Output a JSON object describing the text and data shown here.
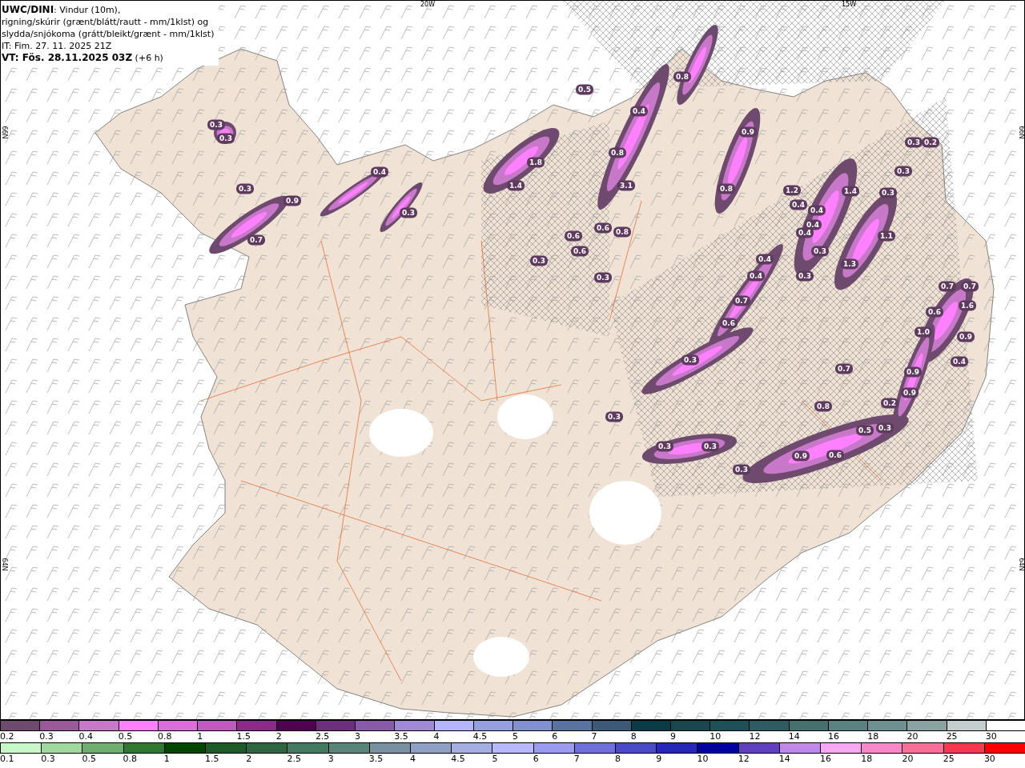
{
  "title_box": {
    "lines": [
      "**UWC/DINI**: Vindur (10m),",
      "rigning/skúrir (grænt/blátt/rautt - mm/1klst) og",
      "slydda/snjókoma (grátt/bleikt/grænt - mm/1klst)",
      "IT: Fim. 27. 11. 2025 21Z",
      "**VT: Fös. 28.11.2025 03Z** (+6 h)"
    ]
  },
  "grid_labels": [
    "20W",
    "15W",
    "66N",
    "66N",
    "64N",
    "64N"
  ],
  "precip_labels": [
    "0.3",
    "0.3",
    "0.3",
    "0.9",
    "0.7",
    "0.4",
    "0.3",
    "0.5",
    "0.8",
    "0.4",
    "0.8",
    "3.1",
    "1.8",
    "1.4",
    "0.6",
    "0.6",
    "0.6",
    "0.8",
    "0.3",
    "0.3",
    "0.9",
    "0.8",
    "1.2",
    "1.4",
    "0.4",
    "0.4",
    "0.4",
    "0.4",
    "0.3",
    "0.3",
    "0.3",
    "0.2",
    "1.1",
    "1.3",
    "0.3",
    "0.4",
    "0.4",
    "0.7",
    "0.6",
    "0.7",
    "0.7",
    "1.6",
    "0.6",
    "1.0",
    "0.9",
    "0.4",
    "0.7",
    "0.9",
    "0.9",
    "0.2",
    "0.8",
    "0.5",
    "0.3",
    "0.3",
    "0.3",
    "0.3",
    "0.3",
    "0.3",
    "0.9",
    "0.6",
    "0.3"
  ],
  "legends": [
    {
      "items": [
        {
          "color": "#6e4a6e",
          "label": "0.2"
        },
        {
          "color": "#9a5a9a",
          "label": "0.3"
        },
        {
          "color": "#c878c8",
          "label": "0.4"
        },
        {
          "color": "#ff80ff",
          "label": "0.5"
        },
        {
          "color": "#dc6edc",
          "label": "0.8"
        },
        {
          "color": "#c05ac0",
          "label": "1"
        },
        {
          "color": "#8c2a8c",
          "label": "1.5"
        },
        {
          "color": "#500050",
          "label": "2"
        },
        {
          "color": "#6e2e7e",
          "label": "2.5"
        },
        {
          "color": "#8a5aaa",
          "label": "3"
        },
        {
          "color": "#a08ad8",
          "label": "3.5"
        },
        {
          "color": "#b4b4ff",
          "label": "4"
        },
        {
          "color": "#96a0e0",
          "label": "4.5"
        },
        {
          "color": "#8090d0",
          "label": "5"
        },
        {
          "color": "#5a72a0",
          "label": "6"
        },
        {
          "color": "#3c5a78",
          "label": "7"
        },
        {
          "color": "#0a3c46",
          "label": "8"
        },
        {
          "color": "#1a4650",
          "label": "9"
        },
        {
          "color": "#1e5058",
          "label": "10"
        },
        {
          "color": "#2e5c62",
          "label": "12"
        },
        {
          "color": "#46706e",
          "label": "14"
        },
        {
          "color": "#5a8280",
          "label": "16"
        },
        {
          "color": "#6e9090",
          "label": "18"
        },
        {
          "color": "#8aa2a2",
          "label": "20"
        },
        {
          "color": "#c4cece",
          "label": "25"
        },
        {
          "color": "#ffffff",
          "label": "30"
        }
      ]
    },
    {
      "items": [
        {
          "color": "#c8f8c8",
          "label": "0.1"
        },
        {
          "color": "#a0d8a0",
          "label": "0.3"
        },
        {
          "color": "#6eae6e",
          "label": "0.5"
        },
        {
          "color": "#307830",
          "label": "0.8"
        },
        {
          "color": "#004600",
          "label": "1"
        },
        {
          "color": "#1e5a28",
          "label": "1.5"
        },
        {
          "color": "#2e6440",
          "label": "2"
        },
        {
          "color": "#447a60",
          "label": "2.5"
        },
        {
          "color": "#5a8478",
          "label": "3"
        },
        {
          "color": "#7890a0",
          "label": "3.5"
        },
        {
          "color": "#8ea0c4",
          "label": "4"
        },
        {
          "color": "#a4aee0",
          "label": "4.5"
        },
        {
          "color": "#b8b8ff",
          "label": "5"
        },
        {
          "color": "#9a9aee",
          "label": "6"
        },
        {
          "color": "#7070dc",
          "label": "7"
        },
        {
          "color": "#4a4ac8",
          "label": "8"
        },
        {
          "color": "#2626b8",
          "label": "9"
        },
        {
          "color": "#0000a0",
          "label": "10"
        },
        {
          "color": "#6040c0",
          "label": "12"
        },
        {
          "color": "#c088e8",
          "label": "14"
        },
        {
          "color": "#f8a8f0",
          "label": "16"
        },
        {
          "color": "#f888c8",
          "label": "18"
        },
        {
          "color": "#f87098",
          "label": "20"
        },
        {
          "color": "#f83850",
          "label": "25"
        },
        {
          "color": "#f80000",
          "label": "30"
        }
      ]
    }
  ]
}
